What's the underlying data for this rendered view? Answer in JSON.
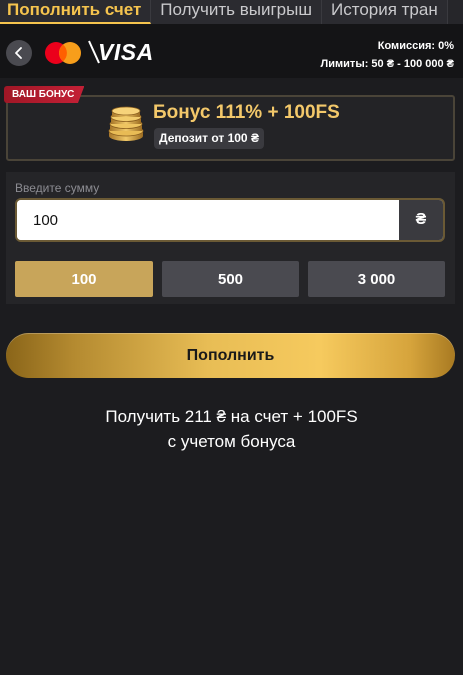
{
  "tabs": [
    {
      "label": "Пополнить счет"
    },
    {
      "label": "Получить выигрыш"
    },
    {
      "label": "История тран"
    }
  ],
  "header": {
    "brand_visa": "VISA",
    "commission": "Комиссия: 0%",
    "limits": "Лимиты: 50 ₴ - 100 000 ₴"
  },
  "bonus": {
    "tag": "ВАШ БОНУС",
    "title": "Бонус 111% + 100FS",
    "subtitle": "Депозит от 100 ₴"
  },
  "amount": {
    "label": "Введите сумму",
    "value": "100",
    "currency": "₴"
  },
  "quick_amounts": [
    "100",
    "500",
    "3 000"
  ],
  "deposit": {
    "label": "Пополнить"
  },
  "receive": {
    "line1": "Получить 211 ₴ на счет + 100FS",
    "line2": "с учетом бонуса"
  },
  "colors": {
    "accent": "#f5c44e",
    "background": "#1c1c1f",
    "bonus_tag": "#b51c2e"
  }
}
